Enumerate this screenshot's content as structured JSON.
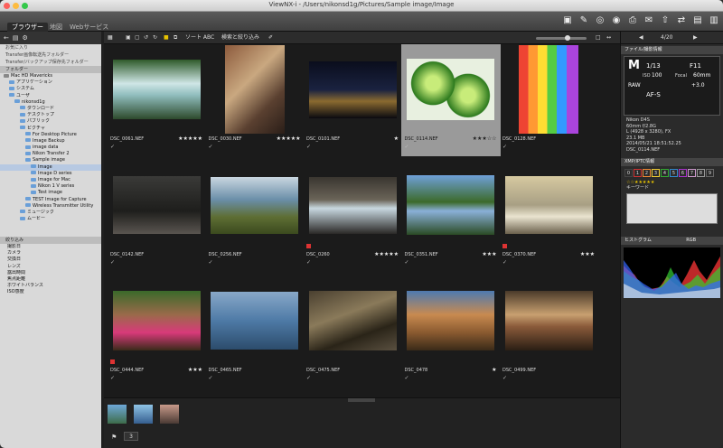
{
  "window": {
    "title": "ViewNX-i - /Users/nikonsd1g/Pictures/Sample image/Image"
  },
  "tabs": [
    "ブラウザー",
    "地図",
    "Webサービス"
  ],
  "left": {
    "top_links": [
      "お気に入り",
      "Transfer画像転送先フォルダー",
      "Transfer/バックアップ保存先フォルダー",
      "フォルダー"
    ],
    "tree": [
      {
        "label": "Mac HD Mavericks",
        "d": 0
      },
      {
        "label": "アプリケーション",
        "d": 1
      },
      {
        "label": "システム",
        "d": 1
      },
      {
        "label": "ユーザ",
        "d": 1
      },
      {
        "label": "nikonsd1g",
        "d": 2
      },
      {
        "label": "ダウンロード",
        "d": 3
      },
      {
        "label": "デスクトップ",
        "d": 3
      },
      {
        "label": "パブリック",
        "d": 3
      },
      {
        "label": "ピクチャ",
        "d": 3
      },
      {
        "label": "For Desktop Picture",
        "d": 4
      },
      {
        "label": "Image Backup",
        "d": 4
      },
      {
        "label": "image data",
        "d": 4
      },
      {
        "label": "Nikon Transfer 2",
        "d": 4
      },
      {
        "label": "Sample image",
        "d": 4
      },
      {
        "label": "Image",
        "d": 5,
        "sel": true
      },
      {
        "label": "Image D series",
        "d": 5
      },
      {
        "label": "Image for Mac",
        "d": 5
      },
      {
        "label": "Nikon 1 V series",
        "d": 5
      },
      {
        "label": "Test image",
        "d": 5
      },
      {
        "label": "TEST Image for Capture",
        "d": 4
      },
      {
        "label": "Wireless Transmitter Utility",
        "d": 4
      },
      {
        "label": "ミュージック",
        "d": 3
      },
      {
        "label": "ムービー",
        "d": 3
      }
    ],
    "filter_title": "絞り込み",
    "filters": [
      "撮影日",
      "カメラ",
      "交換日",
      "レンズ",
      "露出時間",
      "焦点距離",
      "ホワイトバランス",
      "ISO感度"
    ]
  },
  "toolbar": {
    "sort": "ソート ABC",
    "filter": "検索と絞り込み"
  },
  "photos": [
    {
      "name": "DSC_0061.NEF",
      "stars": "★★★★★",
      "tag": false,
      "img": "waterfall"
    },
    {
      "name": "DSC_0030.NEF",
      "stars": "★★★★★",
      "tag": false,
      "img": "city"
    },
    {
      "name": "DSC_0101.NEF",
      "stars": "★",
      "tag": false,
      "img": "bridge"
    },
    {
      "name": "DSC_0114.NEF",
      "stars": "★★★☆☆",
      "tag": false,
      "img": "okra",
      "sel": true
    },
    {
      "name": "DSC_0128.NEF",
      "stars": "",
      "tag": false,
      "img": "rainbow"
    },
    {
      "name": "DSC_0142.NEF",
      "stars": "",
      "tag": false,
      "img": "redcoat"
    },
    {
      "name": "DSC_0256.NEF",
      "stars": "",
      "tag": false,
      "img": "falls2"
    },
    {
      "name": "DSC_0260",
      "stars": "★★★★★",
      "tag": true,
      "img": "river"
    },
    {
      "name": "DSC_0351.NEF",
      "stars": "★★★",
      "tag": false,
      "img": "lake"
    },
    {
      "name": "DSC_0370.NEF",
      "stars": "★★★",
      "tag": true,
      "img": "surf"
    },
    {
      "name": "DSC_0444.NEF",
      "stars": "★★★",
      "tag": true,
      "img": "woman"
    },
    {
      "name": "DSC_0465.NEF",
      "stars": "",
      "tag": false,
      "img": "bird"
    },
    {
      "name": "DSC_0475.NEF",
      "stars": "",
      "tag": false,
      "img": "rock"
    },
    {
      "name": "DSC_0478",
      "stars": "★",
      "tag": false,
      "img": "church"
    },
    {
      "name": "DSC_0499.NEF",
      "stars": "",
      "tag": false,
      "img": "horse"
    }
  ],
  "nav": {
    "page": "4/20"
  },
  "right": {
    "file_info_title": "ファイル/撮影情報",
    "mode": "M",
    "shutter": "1/13",
    "aperture": "F11",
    "iso_label": "ISO",
    "iso": "100",
    "focal_label": "Focal",
    "focal": "60mm",
    "raw": "RAW",
    "ev": "+3.0",
    "wb": "AF-S",
    "info": [
      "Nikon D4S",
      "60mm f/2.8G",
      "L (4928 x 3280), FX",
      "23.1 MB",
      "2014/05/21 18:51:52.25",
      "DSC_0114.NEF"
    ],
    "xmp_title": "XMP/IPTC情報",
    "labels": [
      "0",
      "1",
      "2",
      "3",
      "4",
      "5",
      "6",
      "7",
      "8",
      "9"
    ],
    "keyword": "キーワード",
    "hist_title": "ヒストグラム",
    "hist_mode": "RGB"
  },
  "strip": {
    "count": "3"
  }
}
